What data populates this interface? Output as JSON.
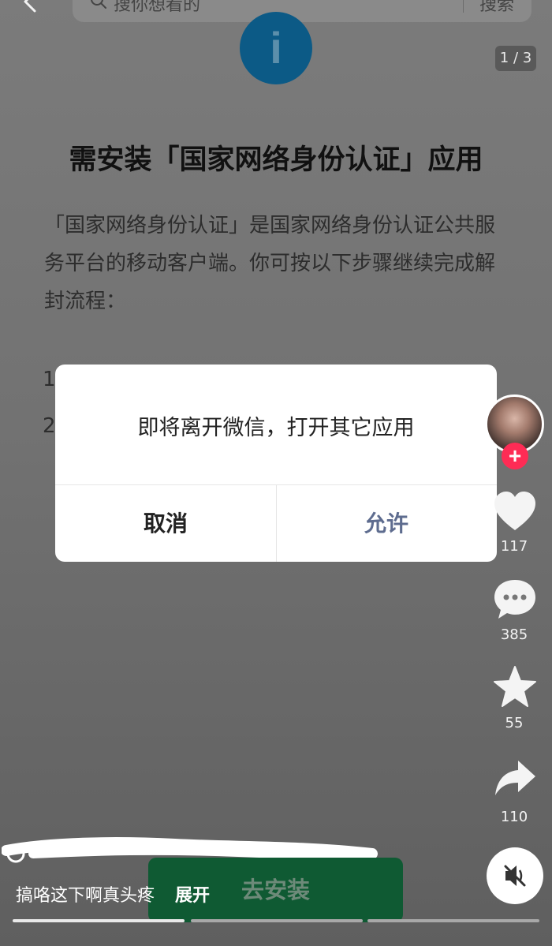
{
  "search": {
    "placeholder": "搜你想看的",
    "button_label": "搜索"
  },
  "info_icon_glyph": "i",
  "page_indicator": "1 / 3",
  "page": {
    "title": "需安装「国家网络身份认证」应用",
    "description": "「国家网络身份认证」是国家网络身份认证公共服务平台的移动客户端。你可按以下步骤继续完成解封流程：",
    "steps": [
      "1",
      "2"
    ]
  },
  "dialog": {
    "message": "即将离开微信，打开其它应用",
    "cancel_label": "取消",
    "allow_label": "允许"
  },
  "rail": {
    "follow_label": "+",
    "likes": "117",
    "comments": "385",
    "favorites": "55",
    "shares": "110"
  },
  "icons": {
    "back": "chevron-left-icon",
    "search": "search-icon",
    "like": "heart-icon",
    "comment": "comment-bubble-icon",
    "favorite": "star-icon",
    "share": "share-arrow-icon",
    "mute": "speaker-muted-icon"
  },
  "bottom": {
    "caption": "搞咯这下啊真头疼",
    "expand_label": "展开",
    "install_label": "去安装"
  },
  "colors": {
    "info_icon": "#0c5a86",
    "allow_button": "#5e6c8f",
    "follow_badge": "#fe2c55",
    "install_button": "#0f5a33"
  }
}
